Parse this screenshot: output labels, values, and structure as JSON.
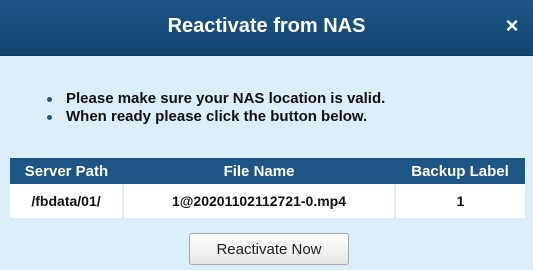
{
  "dialog": {
    "title": "Reactivate from NAS",
    "close_glyph": "×",
    "close_icon": "close-icon"
  },
  "messages": [
    "Please make sure your NAS location is valid.",
    "When ready please click the button below."
  ],
  "table": {
    "headers": [
      "Server Path",
      "File Name",
      "Backup Label"
    ],
    "rows": [
      [
        "/fbdata/01/",
        "1@20201102112721-0.mp4",
        "1"
      ]
    ]
  },
  "button": {
    "label": "Reactivate Now"
  },
  "colors": {
    "title_bar": "#1d5687",
    "header_row": "#1d5585",
    "background": "#dceef7"
  }
}
